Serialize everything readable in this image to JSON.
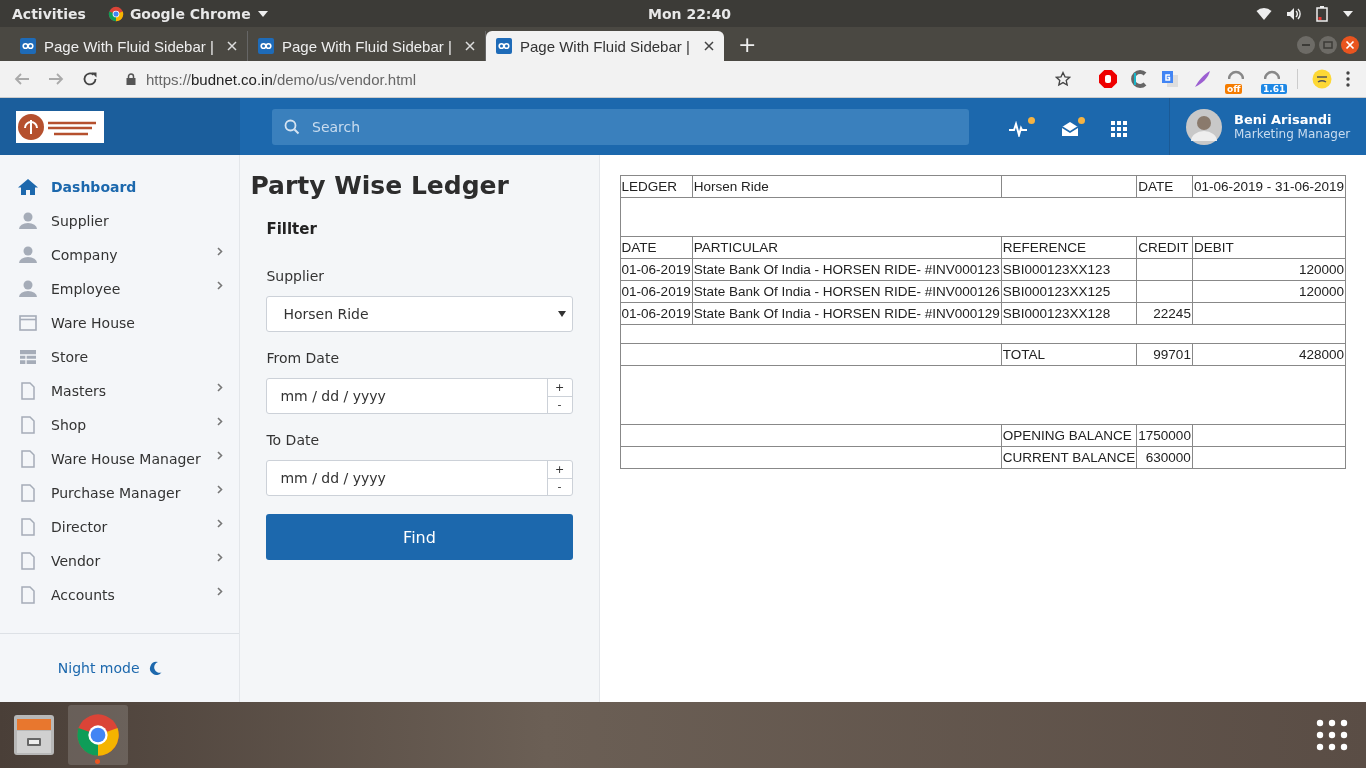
{
  "desktop": {
    "activities": "Activities",
    "app_menu": "Google Chrome",
    "clock": "Mon 22:40"
  },
  "browser": {
    "tabs": [
      {
        "title": "Page With Fluid Sidebar |",
        "selected": false
      },
      {
        "title": "Page With Fluid Sidebar |",
        "selected": false
      },
      {
        "title": "Page With Fluid Sidebar |",
        "selected": true
      }
    ],
    "new_tab": "+",
    "url": {
      "scheme": "https://",
      "host": "budnet.co.in",
      "path": "/demo/us/vendor.html"
    },
    "extensions": [
      {
        "kind": "stop"
      },
      {
        "kind": "c"
      },
      {
        "kind": "translate"
      },
      {
        "kind": "feather"
      },
      {
        "kind": "badge",
        "badge": "off",
        "color": "#f57c00"
      },
      {
        "kind": "badge",
        "badge": "1.61",
        "color": "#1e88e5"
      },
      {
        "kind": "emoji"
      }
    ]
  },
  "header": {
    "search": {
      "placeholder": "Search"
    },
    "notifications": [
      {
        "kind": "activity",
        "unread": true
      },
      {
        "kind": "mail",
        "unread": true
      },
      {
        "kind": "apps"
      }
    ],
    "user": {
      "name": "Beni Arisandi",
      "role": "Marketing Manager"
    }
  },
  "sidebar": {
    "items": [
      {
        "label": "Dashboard",
        "kind": "home",
        "submenu": false,
        "selected": true
      },
      {
        "label": "Supplier",
        "kind": "user",
        "submenu": false,
        "selected": false
      },
      {
        "label": "Company",
        "kind": "user",
        "submenu": true,
        "selected": false
      },
      {
        "label": "Employee",
        "kind": "user",
        "submenu": true,
        "selected": false
      },
      {
        "label": "Ware House",
        "kind": "window",
        "submenu": false,
        "selected": false
      },
      {
        "label": "Store",
        "kind": "table",
        "submenu": false,
        "selected": false
      },
      {
        "label": "Masters",
        "kind": "doc",
        "submenu": true,
        "selected": false
      },
      {
        "label": "Shop",
        "kind": "doc",
        "submenu": true,
        "selected": false
      },
      {
        "label": "Ware House Manager",
        "kind": "doc",
        "submenu": true,
        "selected": false
      },
      {
        "label": "Purchase Manager",
        "kind": "doc",
        "submenu": true,
        "selected": false
      },
      {
        "label": "Director",
        "kind": "doc",
        "submenu": true,
        "selected": false
      },
      {
        "label": "Vendor",
        "kind": "doc",
        "submenu": true,
        "selected": false
      },
      {
        "label": "Accounts",
        "kind": "doc",
        "submenu": true,
        "selected": false
      }
    ],
    "night_mode": "Night mode"
  },
  "filter": {
    "title": "Party Wise Ledger",
    "section": "Fillter",
    "fields": [
      {
        "kind": "select",
        "label": "Supplier",
        "value": "Horsen Ride"
      },
      {
        "kind": "date",
        "label": "From Date",
        "placeholder": "mm / dd / yyyy",
        "up": "+",
        "down": "-"
      },
      {
        "kind": "date",
        "label": "To Date",
        "placeholder": "mm / dd / yyyy",
        "up": "+",
        "down": "-"
      }
    ],
    "button": "Find"
  },
  "ledger": {
    "head": {
      "label": "LEDGER",
      "name": "Horsen Ride",
      "date_label": "DATE",
      "date_range": "01-06-2019 - 31-06-2019"
    },
    "columns": [
      "DATE",
      "PARTICULAR",
      "REFERENCE",
      "CREDIT",
      "DEBIT"
    ],
    "entries": [
      {
        "date": "01-06-2019",
        "particular": "State Bank Of India - HORSEN RIDE- #INV000123",
        "reference": "SBI000123XX123",
        "debit": "120000"
      },
      {
        "date": "01-06-2019",
        "particular": "State Bank Of India - HORSEN RIDE- #INV000126",
        "reference": "SBI000123XX125",
        "debit": "120000"
      },
      {
        "date": "01-06-2019",
        "particular": "State Bank Of India - HORSEN RIDE- #INV000129",
        "reference": "SBI000123XX128",
        "credit": "22245"
      }
    ],
    "total": {
      "label": "TOTAL",
      "credit": "99701",
      "debit": "428000"
    },
    "balances": [
      {
        "label": "OPENING BALANCE",
        "value": "1750000"
      },
      {
        "label": "CURRENT BALANCE",
        "value": "630000"
      }
    ]
  },
  "dock": {
    "apps": [
      {
        "kind": "files",
        "running": false
      },
      {
        "kind": "chrome",
        "running": true
      }
    ]
  }
}
